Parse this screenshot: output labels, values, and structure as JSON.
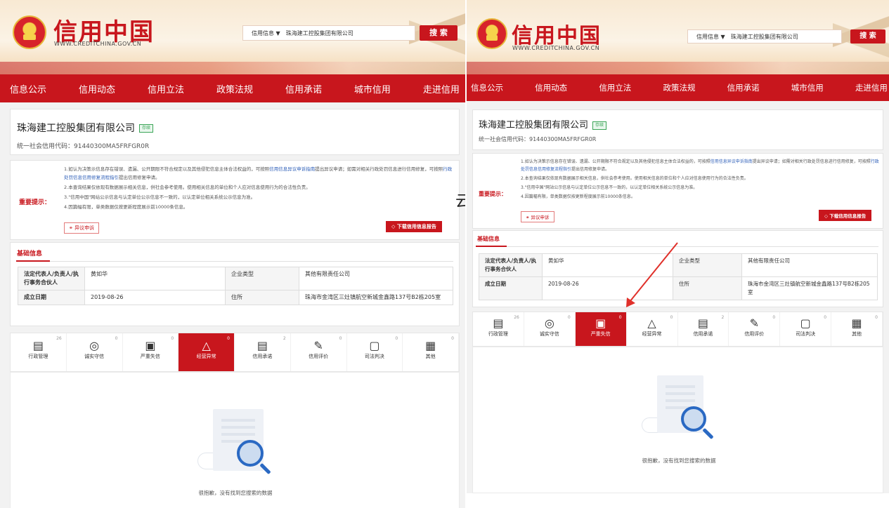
{
  "header": {
    "logo_text": "信用中国",
    "logo_url": "WWW.CREDITCHINA.GOV.CN",
    "search_select": "信用信息 ▼",
    "search_value": "珠海建工控股集团有限公司",
    "search_button": "搜 索"
  },
  "nav": {
    "items": [
      "信息公示",
      "信用动态",
      "信用立法",
      "政策法规",
      "信用承诺",
      "城市信用",
      "走进信用"
    ]
  },
  "company": {
    "name": "珠海建工控股集团有限公司",
    "status": "存续",
    "credit_code": "统一社会信用代码：91440300MA5FRFGR0R"
  },
  "notice": {
    "label": "重要提示：",
    "line1_a": "1.如认为决策示信息存在错误、遗漏、公开期限不符合规定以及其他侵犯信息主体合法权益的，可按照",
    "line1_link": "信用信息异议申诉指南",
    "line1_b": "提出异议申请；如需对相关行政处罚信息进行信用修复，可按照",
    "line1_link2": "行政处罚信息信用修复流程指引",
    "line1_c": "提出信用修复申请。",
    "line2": "2.本查询结果仅依现有数据展示相关信息，供社会参考使用。使用相关信息的单位和个人应对信息使用行为的合法性负责。",
    "line3": "3.\"信用中国\"网站公示信息与认定单位公示信息不一致的，以认定单位相关系统公示信息为准。",
    "line4": "4.因篇幅有限，单类数据仅按更新程度展示前10000条信息。",
    "objection_button": "异议申诉",
    "download_button": "下载信用信息报告"
  },
  "basic": {
    "title": "基础信息",
    "rows": [
      [
        "法定代表人/负责人/执行事务合伙人",
        "黄如华",
        "企业类型",
        "其他有限责任公司"
      ],
      [
        "成立日期",
        "2019-08-26",
        "住所",
        "珠海市金湾区三灶镇航空新城金鑫路137号B2栋205室"
      ]
    ]
  },
  "tabs": [
    {
      "label": "行政管理",
      "count": "26",
      "icon": "admin-icon"
    },
    {
      "label": "诚实守信",
      "count": "0",
      "icon": "honesty-icon"
    },
    {
      "label": "严重失信",
      "count": "0",
      "icon": "serious-dishonesty-icon"
    },
    {
      "label": "经营异常",
      "count": "0",
      "icon": "abnormal-operation-icon"
    },
    {
      "label": "信用承诺",
      "count": "2",
      "icon": "credit-promise-icon"
    },
    {
      "label": "信用评价",
      "count": "0",
      "icon": "credit-evaluation-icon"
    },
    {
      "label": "司法判决",
      "count": "0",
      "icon": "judicial-icon"
    },
    {
      "label": "其他",
      "count": "0",
      "icon": "other-icon"
    }
  ],
  "left_active_tab": 3,
  "right_active_tab": 2,
  "empty_text": "很抱歉，没有找到您搜索的数据",
  "gap_glyph": "云",
  "colors": {
    "brand_red": "#c8161d",
    "link_blue": "#2e5fb8",
    "status_green": "#3aa556"
  }
}
